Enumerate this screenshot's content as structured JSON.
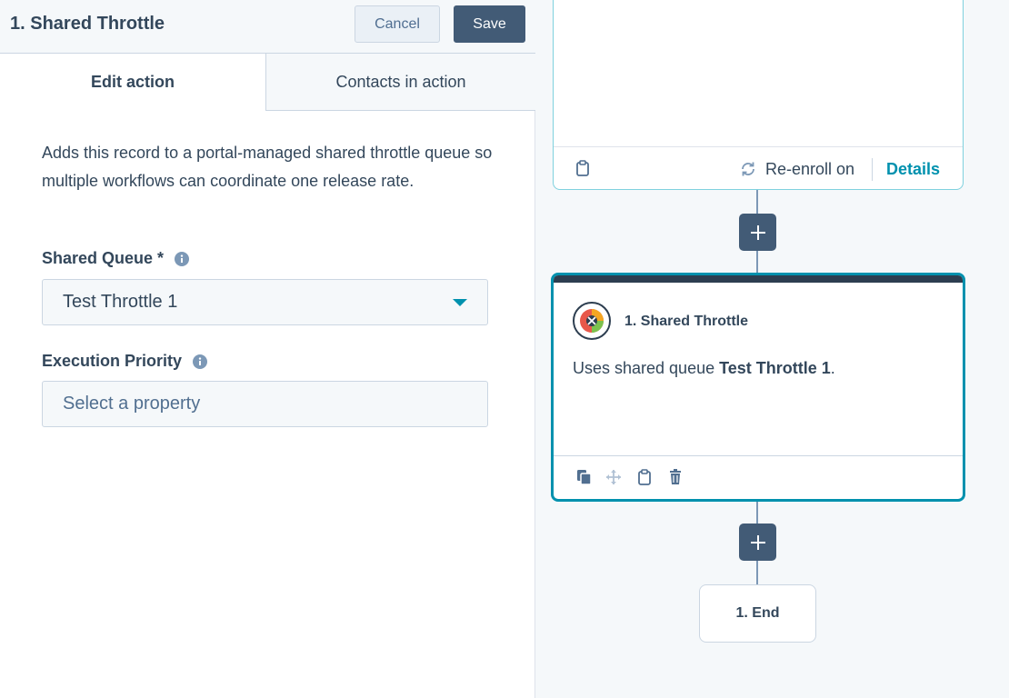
{
  "panel": {
    "title": "1. Shared Throttle",
    "cancel_label": "Cancel",
    "save_label": "Save",
    "tabs": [
      {
        "label": "Edit action",
        "active": true
      },
      {
        "label": "Contacts in action",
        "active": false
      }
    ],
    "description": "Adds this record to a portal-managed shared throttle queue so multiple workflows can coordinate one release rate.",
    "fields": {
      "shared_queue": {
        "label": "Shared Queue *",
        "value": "Test Throttle 1"
      },
      "execution_priority": {
        "label": "Execution Priority",
        "placeholder": "Select a property"
      }
    }
  },
  "canvas": {
    "previous_action": {
      "reenroll_label": "Re-enroll on",
      "details_label": "Details"
    },
    "current_action": {
      "title": "1. Shared Throttle",
      "body_prefix": "Uses shared queue ",
      "body_queue": "Test Throttle 1",
      "body_suffix": "."
    },
    "end_node": {
      "label": "1. End"
    }
  },
  "icons": {
    "info": "info-icon",
    "caret": "chevron-down-icon",
    "plus": "plus-icon",
    "clipboard": "clipboard-icon",
    "reenroll": "refresh-icon",
    "copy": "copy-icon",
    "move": "move-icon",
    "delete": "trash-icon",
    "app_logo": "app-logo-icon"
  },
  "colors": {
    "primary_dark": "#425b76",
    "accent_teal": "#0091ae",
    "text": "#33475b",
    "panel_bg": "#f5f8fa"
  }
}
